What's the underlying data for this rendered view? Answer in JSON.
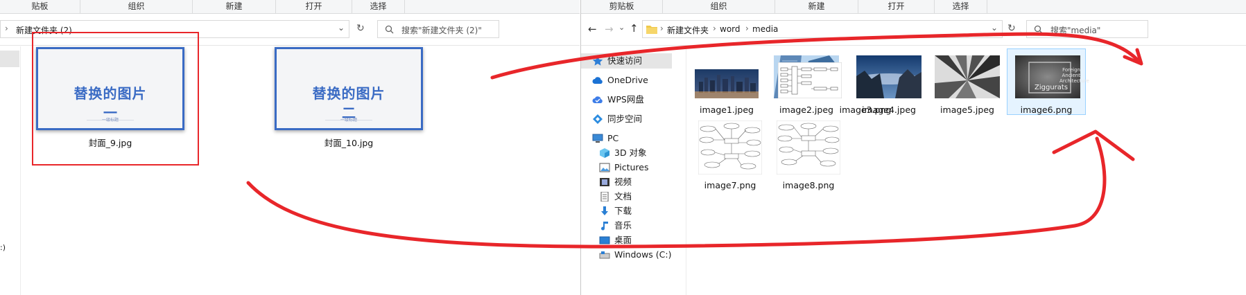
{
  "left": {
    "ribbon": {
      "clipboard": "贴板",
      "organize": "组织",
      "new": "新建",
      "open": "打开",
      "select": "选择"
    },
    "path": "新建文件夹 (2)",
    "search_placeholder": "搜索\"新建文件夹 (2)\"",
    "files": [
      {
        "name": "封面_9.jpg",
        "title": "替换的图片",
        "num": "一",
        "sub": "一级标题"
      },
      {
        "name": "封面_10.jpg",
        "title": "替换的图片",
        "num": "二",
        "sub": "一级标题"
      }
    ],
    "nav_fragment": ":)"
  },
  "right": {
    "ribbon": {
      "clipboard": "剪贴板",
      "organize": "组织",
      "new": "新建",
      "open": "打开",
      "select": "选择"
    },
    "breadcrumb": [
      "新建文件夹",
      "word",
      "media"
    ],
    "search_placeholder": "搜索\"media\"",
    "nav": [
      {
        "label": "快速访问",
        "icon": "star-icon"
      },
      {
        "label": "OneDrive",
        "icon": "cloud-icon"
      },
      {
        "label": "WPS网盘",
        "icon": "wps-cloud-icon"
      },
      {
        "label": "同步空间",
        "icon": "sync-icon"
      },
      {
        "label": "PC",
        "icon": "computer-icon"
      },
      {
        "label": "3D 对象",
        "icon": "cube-icon"
      },
      {
        "label": "Pictures",
        "icon": "pictures-icon"
      },
      {
        "label": "视频",
        "icon": "video-icon"
      },
      {
        "label": "文档",
        "icon": "document-icon"
      },
      {
        "label": "下载",
        "icon": "download-icon"
      },
      {
        "label": "音乐",
        "icon": "music-icon"
      },
      {
        "label": "桌面",
        "icon": "desktop-icon"
      },
      {
        "label": "Windows (C:)",
        "icon": "drive-icon"
      }
    ],
    "files": [
      {
        "name": "image1.jpeg"
      },
      {
        "name": "image2.jpeg"
      },
      {
        "name": "image3.png"
      },
      {
        "name": "image4.jpeg"
      },
      {
        "name": "image5.jpeg"
      },
      {
        "name": "image6.png",
        "overlay": [
          "Foreign",
          "Ancient",
          "Architecture",
          "Ziggurats"
        ]
      },
      {
        "name": "image7.png"
      },
      {
        "name": "image8.png"
      }
    ]
  },
  "colors": {
    "accent": "#3a6bc4",
    "annotation": "#e8262a",
    "selection": "#cce8ff"
  }
}
